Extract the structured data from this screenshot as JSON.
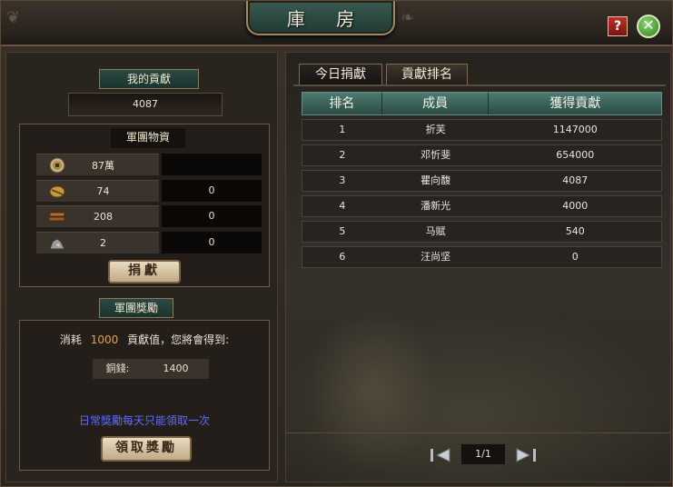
{
  "window": {
    "title": "庫 房"
  },
  "controls": {
    "help": "?",
    "close": "✕"
  },
  "left": {
    "contribution_label": "我的貢獻",
    "contribution_value": "4087",
    "materials_label": "軍團物資",
    "resources": [
      {
        "icon": "coin-icon",
        "amount": "87萬",
        "input": ""
      },
      {
        "icon": "grain-icon",
        "amount": "74",
        "input": "0"
      },
      {
        "icon": "wood-icon",
        "amount": "208",
        "input": "0"
      },
      {
        "icon": "ore-icon",
        "amount": "2",
        "input": "0"
      }
    ],
    "donate_button": "捐獻",
    "reward_label": "軍團獎勵",
    "reward_prefix": "消耗",
    "reward_cost": "1000",
    "reward_suffix": "貢獻值，您將會得到:",
    "copper_label": "銅錢:",
    "copper_value": "1400",
    "daily_note": "日常獎勵每天只能領取一次",
    "claim_button": "領取獎勵"
  },
  "right": {
    "tabs": [
      "今日捐獻",
      "貢獻排名"
    ],
    "columns": [
      "排名",
      "成員",
      "獲得貢獻"
    ],
    "rows": [
      {
        "rank": "1",
        "member": "折芙",
        "contribution": "1147000"
      },
      {
        "rank": "2",
        "member": "邓忻斐",
        "contribution": "654000"
      },
      {
        "rank": "3",
        "member": "瞿向馥",
        "contribution": "4087"
      },
      {
        "rank": "4",
        "member": "潘新光",
        "contribution": "4000"
      },
      {
        "rank": "5",
        "member": "马赋",
        "contribution": "540"
      },
      {
        "rank": "6",
        "member": "汪尚坚",
        "contribution": "0"
      }
    ],
    "page": "1/1"
  },
  "colors": {
    "accent_teal": "#2a4c44",
    "reward_cost": "#e0a050",
    "note_blue": "#5a6cff"
  }
}
